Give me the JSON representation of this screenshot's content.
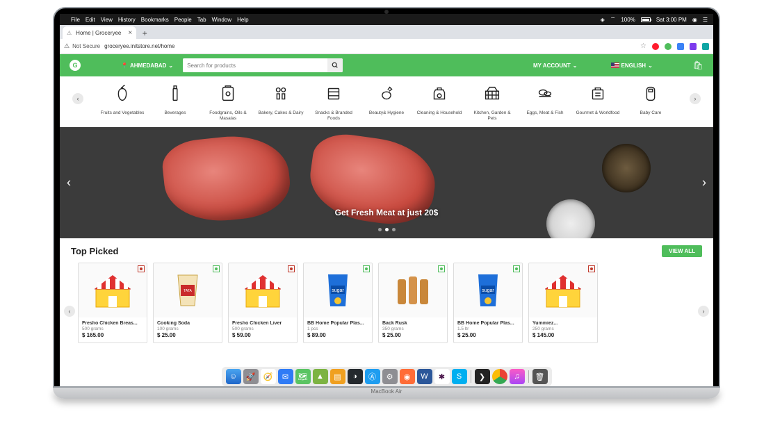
{
  "mac": {
    "menus": [
      "File",
      "Edit",
      "View",
      "History",
      "Bookmarks",
      "People",
      "Tab",
      "Window",
      "Help"
    ],
    "wifi": "100%",
    "batt_icon": "100%",
    "time": "Sat 3:00 PM"
  },
  "chrome": {
    "tab_title": "Home | Groceryee",
    "not_secure": "Not Secure",
    "url": "groceryee.initstore.net/home"
  },
  "header": {
    "location": "AHMEDABAD",
    "search_placeholder": "Search for products",
    "my_account": "MY ACCOUNT",
    "language": "ENGLISH"
  },
  "categories": [
    {
      "label": "Fruits and Vegetables"
    },
    {
      "label": "Beverages"
    },
    {
      "label": "Foodgrains, Oils & Masalas"
    },
    {
      "label": "Bakery, Cakes & Dairy"
    },
    {
      "label": "Snacks & Branded Foods"
    },
    {
      "label": "Beauty& Hygiene"
    },
    {
      "label": "Cleaning & Household"
    },
    {
      "label": "Kitchen, Garden & Pets"
    },
    {
      "label": "Eggs, Meat & Fish"
    },
    {
      "label": "Gourmet & Worldfood"
    },
    {
      "label": "Baby Care"
    }
  ],
  "hero": {
    "caption": "Get Fresh Meat at just 20$"
  },
  "top_picked": {
    "title": "Top Picked",
    "view_all": "VIEW ALL",
    "products": [
      {
        "name": "Fresho Chicken Breas...",
        "qty": "500 grams",
        "price": "$ 165.00",
        "veg": false
      },
      {
        "name": "Cooking Soda",
        "qty": "100 grams",
        "price": "$ 25.00",
        "veg": true
      },
      {
        "name": "Fresho Chicken Liver",
        "qty": "500 grams",
        "price": "$ 59.00",
        "veg": false
      },
      {
        "name": "BB Home Popular Plas...",
        "qty": "1 pcs",
        "price": "$ 89.00",
        "veg": true
      },
      {
        "name": "Back Rusk",
        "qty": "350 grams",
        "price": "$ 25.00",
        "veg": true
      },
      {
        "name": "BB Home Popular Plas...",
        "qty": "1.5 ltr",
        "price": "$ 25.00",
        "veg": true
      },
      {
        "name": "Yummiez...",
        "qty": "250 grams",
        "price": "$ 145.00",
        "veg": false
      }
    ]
  }
}
